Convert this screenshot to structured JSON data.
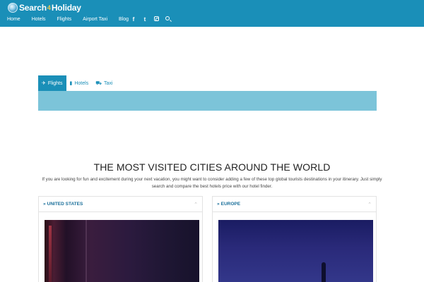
{
  "header": {
    "logo_part1": "Search",
    "logo_sep": "4",
    "logo_part2": "Holiday",
    "nav": [
      "Home",
      "Hotels",
      "Flights",
      "Airport Taxi",
      "Blog"
    ],
    "social_icons": [
      "facebook-icon",
      "twitter-icon",
      "instagram-icon",
      "search-icon"
    ],
    "social_glyphs": {
      "facebook": "f",
      "twitter": "t"
    }
  },
  "search": {
    "tabs": [
      {
        "label": "Flights",
        "icon": "plane-icon",
        "glyph": "✈",
        "active": true
      },
      {
        "label": "Hotels",
        "icon": "building-icon",
        "glyph": "▮",
        "active": false
      },
      {
        "label": "Taxi",
        "icon": "car-icon",
        "glyph": "⛟",
        "active": false
      }
    ]
  },
  "section": {
    "title": "THE MOST VISITED CITIES AROUND THE WORLD",
    "description": "If you are looking for fun and excitement during your next vacation, you might want to consider adding a few of these top global tourists destinations in your itinerary. Just simply search and compare the best hotels price with our hotel finder."
  },
  "cards": [
    {
      "title": "UNITED STATES",
      "chevron": "»",
      "caret": "⌃"
    },
    {
      "title": "EUROPE",
      "chevron": "»",
      "caret": "⌃"
    }
  ],
  "colors": {
    "brand": "#1a8fb8",
    "search_panel": "#7cc4d9",
    "card_title": "#1a6f9a"
  }
}
